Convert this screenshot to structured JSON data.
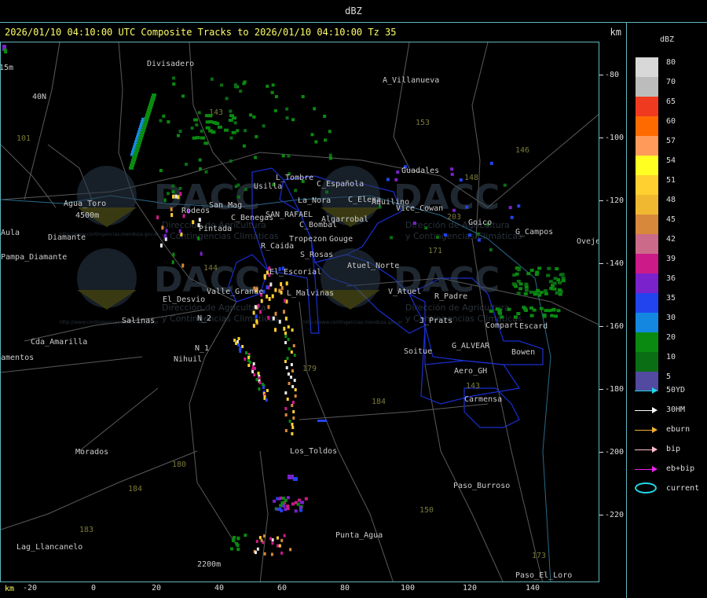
{
  "window": {
    "title": "dBZ"
  },
  "header": {
    "title": "2026/01/10 04:10:00 UTC Composite Tracks to 2026/01/10 04:10:00 Tz 35",
    "unit": "km"
  },
  "axes": {
    "x_unit": "km",
    "x_ticks": [
      "-20",
      "0",
      "20",
      "40",
      "60",
      "80",
      "100",
      "120",
      "140"
    ],
    "y_ticks": [
      "-80",
      "-100",
      "-120",
      "-140",
      "-160",
      "-180",
      "-200",
      "-220"
    ]
  },
  "colors": {
    "frame": "#5fb6c0",
    "title_text": "#ffff66",
    "boundary": "#1a2fd0"
  },
  "legend": {
    "title": "dBZ",
    "scale": [
      {
        "label": "80",
        "color": "#d8d8d8"
      },
      {
        "label": "70",
        "color": "#bcbcbc"
      },
      {
        "label": "65",
        "color": "#f03a20"
      },
      {
        "label": "60",
        "color": "#ff6a00"
      },
      {
        "label": "57",
        "color": "#ff9a5a"
      },
      {
        "label": "54",
        "color": "#ffff22"
      },
      {
        "label": "51",
        "color": "#ffd030"
      },
      {
        "label": "48",
        "color": "#f0b830"
      },
      {
        "label": "45",
        "color": "#d8883a"
      },
      {
        "label": "42",
        "color": "#cc6a8a"
      },
      {
        "label": "39",
        "color": "#cc1a88"
      },
      {
        "label": "36",
        "color": "#7a22cc"
      },
      {
        "label": "35",
        "color": "#2244ee"
      },
      {
        "label": "30",
        "color": "#1488e0"
      },
      {
        "label": "20",
        "color": "#0a8a10"
      },
      {
        "label": "10",
        "color": "#0a6e14"
      },
      {
        "label": "5",
        "color": "#524aa0"
      }
    ],
    "tracks": [
      {
        "label": "50YD",
        "color": "#22d8e8"
      },
      {
        "label": "30HM",
        "color": "#ffffff"
      },
      {
        "label": "eburn",
        "color": "#f0b030"
      },
      {
        "label": "bip",
        "color": "#ffc0d0"
      },
      {
        "label": "eb+bip",
        "color": "#ee22ee"
      },
      {
        "label": "current",
        "color": "#22d8e8"
      }
    ]
  },
  "watermark": {
    "brand": "DACC",
    "line1": "Dirección de Agricultura",
    "line2": "y Contingencias Climáticas",
    "url": "http://www.contingencias.mendoza.gov.ar"
  },
  "places": [
    "Divisadero",
    "A_Villanueva",
    "Guadales",
    "Usilla",
    "L_Tombre",
    "C_Española",
    "La_Nora",
    "C_Elena",
    "Aquilino",
    "Vice_Cowan",
    "Rodeos",
    "San Mag",
    "Pintada",
    "C_Benegas",
    "SAN_RAFAEL",
    "Algarrobal",
    "C_Bombal",
    "Tropezon",
    "Gouge",
    "Goico",
    "G_Campos",
    "Agua_Toro",
    "Pampa_Diamante",
    "Diamante",
    "R_Caida",
    "S_Rosas",
    "Atuel_Norte",
    "Oveje",
    "El_Escorial",
    "Valle_Grande",
    "L_Malvinas",
    "El_Desvio",
    "V_Atuel",
    "R_Padre",
    "Salinas",
    "N_2",
    "J_Prats",
    "Compart",
    "Escard",
    "G_ALVEAR",
    "Cda_Amarilla",
    "amentos",
    "N_1",
    "Nihuil",
    "Soitue",
    "Bowen",
    "Aero_GH",
    "Carmensa",
    "Los_Toldos",
    "Morados",
    "Paso_Burroso",
    "Punta_Agua",
    "Lag_Llancanelo",
    "Paso_El_Loro",
    "Aula",
    "15m",
    "40N",
    "2200m",
    "4500m"
  ],
  "route_numbers": [
    "101",
    "143",
    "153",
    "146",
    "148",
    "203",
    "171",
    "144",
    "179",
    "184",
    "180",
    "143",
    "150",
    "184",
    "183",
    "173"
  ]
}
